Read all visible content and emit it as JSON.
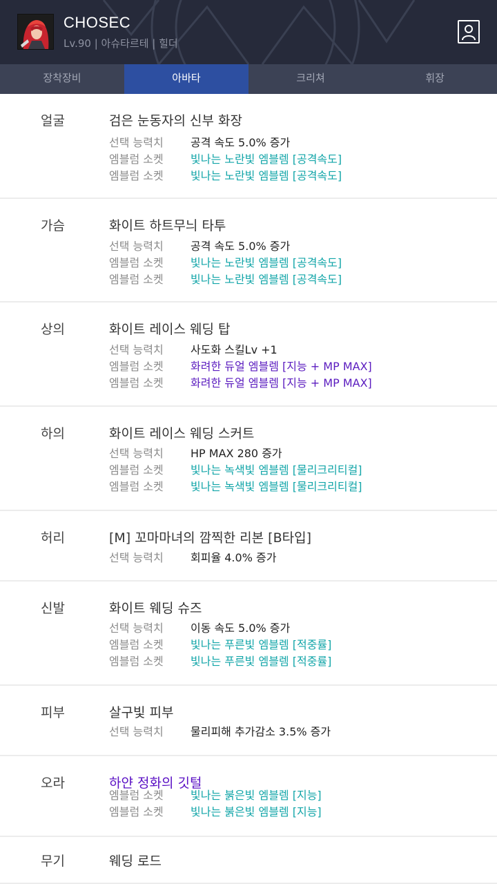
{
  "header": {
    "character_name": "CHOSEC",
    "character_info": "Lv.90 | 아슈타르테 | 힐더",
    "avatar_icon": "character-portrait-icon",
    "profile_icon": "profile-icon",
    "background_color": "#262a3a"
  },
  "tabs": [
    {
      "label": "장착장비",
      "active": false
    },
    {
      "label": "아바타",
      "active": true
    },
    {
      "label": "크리쳐",
      "active": false
    },
    {
      "label": "휘장",
      "active": false
    }
  ],
  "colors": {
    "tab_active": "#2d4fa1",
    "emblem_teal": "#12a5a8",
    "emblem_purple": "#5a1bbf"
  },
  "avatar_items": [
    {
      "slot": "얼굴",
      "name": "검은 눈동자의 신부 화장",
      "lines": [
        {
          "label": "선택 능력치",
          "value": "공격 속도 5.0% 증가"
        },
        {
          "label": "엠블럼 소켓",
          "value": "빛나는 노란빛 엠블렘 [공격속도]"
        },
        {
          "label": "엠블럼 소켓",
          "value": "빛나는 노란빛 엠블렘 [공격속도]"
        }
      ]
    },
    {
      "slot": "가슴",
      "name": "화이트 하트무늬 타투",
      "lines": [
        {
          "label": "선택 능력치",
          "value": "공격 속도 5.0% 증가"
        },
        {
          "label": "엠블럼 소켓",
          "value": "빛나는 노란빛 엠블렘 [공격속도]"
        },
        {
          "label": "엠블럼 소켓",
          "value": "빛나는 노란빛 엠블렘 [공격속도]"
        }
      ]
    },
    {
      "slot": "상의",
      "name": "화이트 레이스 웨딩 탑",
      "lines": [
        {
          "label": "선택 능력치",
          "value": "사도화 스킬Lv +1"
        },
        {
          "label": "엠블럼 소켓",
          "value": "화려한 듀얼 엠블렘 [지능 + MP MAX]"
        },
        {
          "label": "엠블럼 소켓",
          "value": "화려한 듀얼 엠블렘 [지능 + MP MAX]"
        }
      ]
    },
    {
      "slot": "하의",
      "name": "화이트 레이스 웨딩 스커트",
      "lines": [
        {
          "label": "선택 능력치",
          "value": "HP MAX 280 증가"
        },
        {
          "label": "엠블럼 소켓",
          "value": "빛나는 녹색빛 엠블렘 [물리크리티컬]"
        },
        {
          "label": "엠블럼 소켓",
          "value": "빛나는 녹색빛 엠블렘 [물리크리티컬]"
        }
      ]
    },
    {
      "slot": "허리",
      "name": "[M] 꼬마마녀의 깜찍한 리본 [B타입]",
      "lines": [
        {
          "label": "선택 능력치",
          "value": "회피율 4.0% 증가"
        }
      ]
    },
    {
      "slot": "신발",
      "name": "화이트 웨딩 슈즈",
      "lines": [
        {
          "label": "선택 능력치",
          "value": "이동 속도 5.0% 증가"
        },
        {
          "label": "엠블럼 소켓",
          "value": "빛나는 푸른빛 엠블렘 [적중률]"
        },
        {
          "label": "엠블럼 소켓",
          "value": "빛나는 푸른빛 엠블렘 [적중률]"
        }
      ]
    },
    {
      "slot": "피부",
      "name": "살구빛 피부",
      "lines": [
        {
          "label": "선택 능력치",
          "value": "물리피해 추가감소 3.5% 증가"
        }
      ]
    },
    {
      "slot": "오라",
      "name": "하얀 정화의 깃털",
      "lines": [
        {
          "label": "엠블럼 소켓",
          "value": "빛나는 붉은빛 엠블렘 [지능]"
        },
        {
          "label": "엠블럼 소켓",
          "value": "빛나는 붉은빛 엠블렘 [지능]"
        }
      ]
    },
    {
      "slot": "무기",
      "name": "웨딩 로드",
      "lines": []
    }
  ]
}
